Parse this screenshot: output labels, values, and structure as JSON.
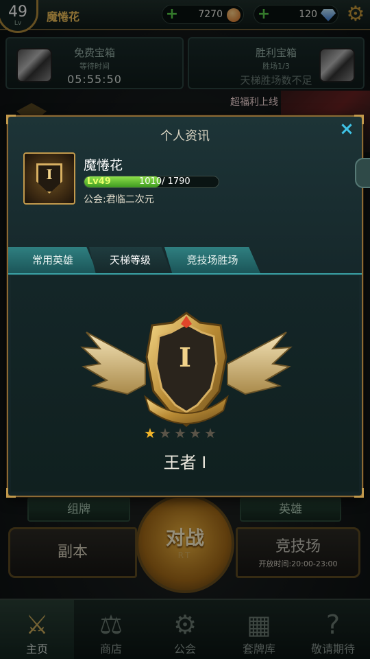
{
  "header": {
    "level": "49",
    "level_label": "Lv",
    "player_name": "魔惓花",
    "gold": "7270",
    "gems": "120",
    "plus_icon": "+",
    "settings_icon": "gear-icon"
  },
  "chests": {
    "free": {
      "title": "免费宝箱",
      "subtitle": "等待时间",
      "time": "05:55:50"
    },
    "victory": {
      "title": "胜利宝箱",
      "subtitle": "胜场1/3",
      "status": "天梯胜场数不足"
    }
  },
  "promo": {
    "text": "超福利上线"
  },
  "modal": {
    "title": "个人资讯",
    "close_icon": "×",
    "player": {
      "name": "魔惓花",
      "rank_numeral": "I",
      "level_label": "Lv49",
      "xp_current": 1010,
      "xp_max": 1790,
      "xp_text": "1010/ 1790",
      "guild": "公会:君临二次元"
    },
    "tabs": [
      {
        "label": "常用英雄",
        "active": false
      },
      {
        "label": "天梯等级",
        "active": true
      },
      {
        "label": "竞技场胜场",
        "active": false
      }
    ],
    "rank": {
      "numeral": "I",
      "stars_filled": 1,
      "stars_total": 5,
      "title": "王者 I"
    }
  },
  "main_buttons": {
    "deck": "组牌",
    "heroes": "英雄",
    "dungeon": "副本",
    "battle": "对战",
    "battle_sub": "RT",
    "arena": "竞技场",
    "arena_hours": "开放时间:20:00-23:00"
  },
  "nav": [
    {
      "label": "主页",
      "icon": "swords-icon",
      "glyph": "⚔",
      "active": true
    },
    {
      "label": "商店",
      "icon": "scales-icon",
      "glyph": "⚖",
      "active": false
    },
    {
      "label": "公会",
      "icon": "guild-emblem-icon",
      "glyph": "⚙",
      "active": false
    },
    {
      "label": "套牌库",
      "icon": "cards-icon",
      "glyph": "▦",
      "active": false
    },
    {
      "label": "敬请期待",
      "icon": "question-icon",
      "glyph": "?",
      "active": false
    }
  ],
  "colors": {
    "accent_gold": "#c39a4c",
    "xp_green": "#6fc83a",
    "tab_teal": "#2f7f80",
    "close_cyan": "#3fc3e6",
    "star_gold": "#f2b52a"
  }
}
